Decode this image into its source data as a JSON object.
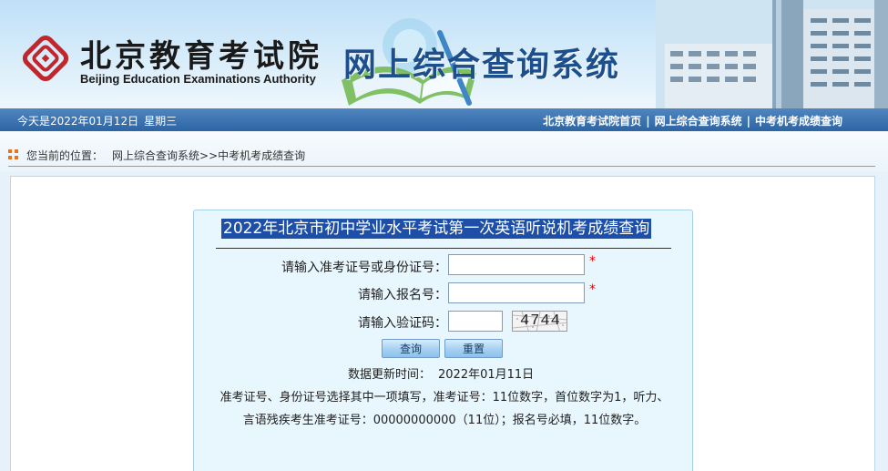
{
  "header": {
    "org_name_cn": "北京教育考试院",
    "org_name_en": "Beijing Education Examinations Authority",
    "system_title": "网上综合查询系统",
    "logo_icon": "bjeea-logo-icon",
    "brand_color": "#c0262c",
    "title_color": "#1d4f8c"
  },
  "navbar": {
    "date_text": "今天是2022年01月12日",
    "weekday": "星期三",
    "links": [
      {
        "label": "北京教育考试院首页"
      },
      {
        "label": "网上综合查询系统"
      },
      {
        "label": "中考机考成绩查询"
      }
    ],
    "separator": "|",
    "bg_color": "#3a72b2"
  },
  "breadcrumb": {
    "prefix": "您当前的位置：",
    "path": [
      "网上综合查询系统",
      ">>中考机考成绩查询"
    ],
    "icon": "grid-dots-icon"
  },
  "form": {
    "title": "2022年北京市初中学业水平考试第一次英语听说机考成绩查询",
    "fields": {
      "exam_id": {
        "label": "请输入准考证号或身份证号：",
        "value": "",
        "required_mark": "*"
      },
      "reg_no": {
        "label": "请输入报名号：",
        "value": "",
        "required_mark": "*"
      },
      "captcha": {
        "label": "请输入验证码：",
        "value": "",
        "image_text": "4744"
      }
    },
    "buttons": {
      "query": "查询",
      "reset": "重置"
    },
    "update_label": "数据更新时间：",
    "update_value": "2022年01月11日",
    "note": "准考证号、身份证号选择其中一项填写，准考证号：11位数字，首位数字为1，听力、言语残疾考生准考证号：00000000000（11位）；报名号必填，11位数字。"
  }
}
